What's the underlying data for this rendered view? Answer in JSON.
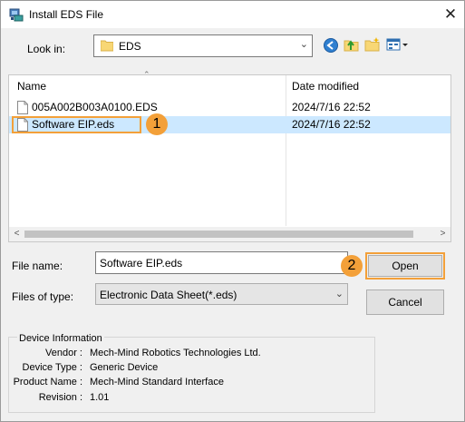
{
  "window": {
    "title": "Install EDS File",
    "close_glyph": "✕"
  },
  "lookin": {
    "label": "Look in:",
    "value": "EDS"
  },
  "columns": {
    "name": "Name",
    "date": "Date modified"
  },
  "files": [
    {
      "name": "005A002B003A0100.EDS",
      "date": "2024/7/16 22:52"
    },
    {
      "name": "Software EIP.eds",
      "date": "2024/7/16 22:52"
    }
  ],
  "badges": {
    "one": "1",
    "two": "2"
  },
  "filename": {
    "label": "File name:",
    "value": "Software EIP.eds"
  },
  "filetype": {
    "label": "Files of type:",
    "value": "Electronic Data Sheet(*.eds)"
  },
  "buttons": {
    "open": "Open",
    "cancel": "Cancel"
  },
  "device_info": {
    "title": "Device Information",
    "rows": [
      {
        "key": "Vendor :",
        "value": "Mech-Mind Robotics Technologies Ltd."
      },
      {
        "key": "Device Type :",
        "value": "Generic Device"
      },
      {
        "key": "Product Name :",
        "value": "Mech-Mind Standard Interface"
      },
      {
        "key": "Revision :",
        "value": "1.01"
      }
    ]
  },
  "colors": {
    "highlight": "#f3a039",
    "selection": "#cce8ff"
  }
}
